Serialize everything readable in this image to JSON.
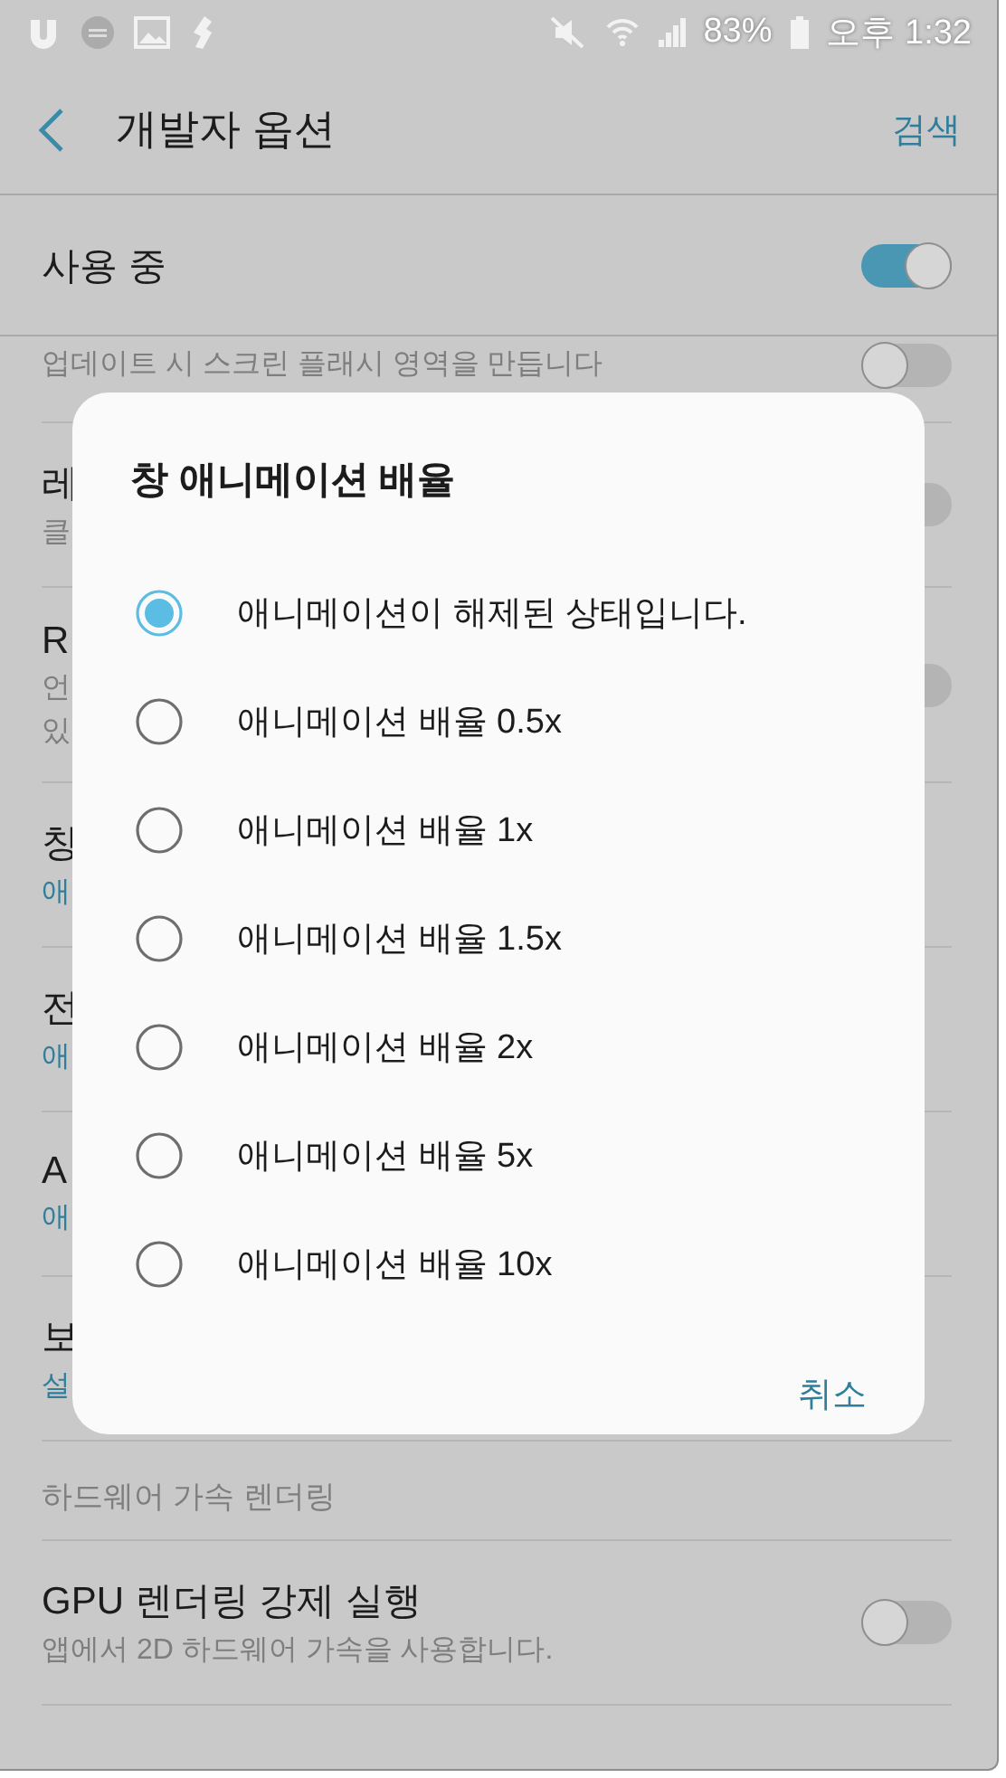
{
  "status_bar": {
    "battery_text": "83%",
    "time": "오후 1:32"
  },
  "header": {
    "title": "개발자 옵션",
    "action": "검색"
  },
  "master_switch": {
    "label": "사용 중",
    "on": true
  },
  "settings": {
    "items": [
      {
        "kind": "toggle",
        "subtitle": [
          "업데이트 시 스크린 플래시 영역을 만듭니다"
        ],
        "on": false
      },
      {
        "kind": "toggle",
        "title": "레",
        "subtitle": [
          "클"
        ],
        "on": false
      },
      {
        "kind": "toggle",
        "title": "R",
        "subtitle": [
          "언",
          "있"
        ],
        "on": false
      },
      {
        "kind": "value",
        "title": "창",
        "subtitle": [
          "애"
        ]
      },
      {
        "kind": "value",
        "title": "전",
        "subtitle": [
          "애"
        ]
      },
      {
        "kind": "value",
        "title": "A",
        "subtitle": [
          "애"
        ]
      },
      {
        "kind": "value",
        "title": "보",
        "subtitle": [
          "설"
        ]
      },
      {
        "kind": "section",
        "title": "하드웨어 가속 렌더링"
      },
      {
        "kind": "toggle",
        "title": "GPU 렌더링 강제 실행",
        "subtitle": [
          "앱에서 2D 하드웨어 가속을 사용합니다."
        ],
        "on": false
      }
    ]
  },
  "dialog": {
    "title": "창 애니메이션 배율",
    "options": [
      {
        "label": "애니메이션이 해제된 상태입니다.",
        "selected": true
      },
      {
        "label": "애니메이션 배율 0.5x",
        "selected": false
      },
      {
        "label": "애니메이션 배율 1x",
        "selected": false
      },
      {
        "label": "애니메이션 배율 1.5x",
        "selected": false
      },
      {
        "label": "애니메이션 배율 2x",
        "selected": false
      },
      {
        "label": "애니메이션 배율 5x",
        "selected": false
      },
      {
        "label": "애니메이션 배율 10x",
        "selected": false
      }
    ],
    "cancel": "취소"
  }
}
